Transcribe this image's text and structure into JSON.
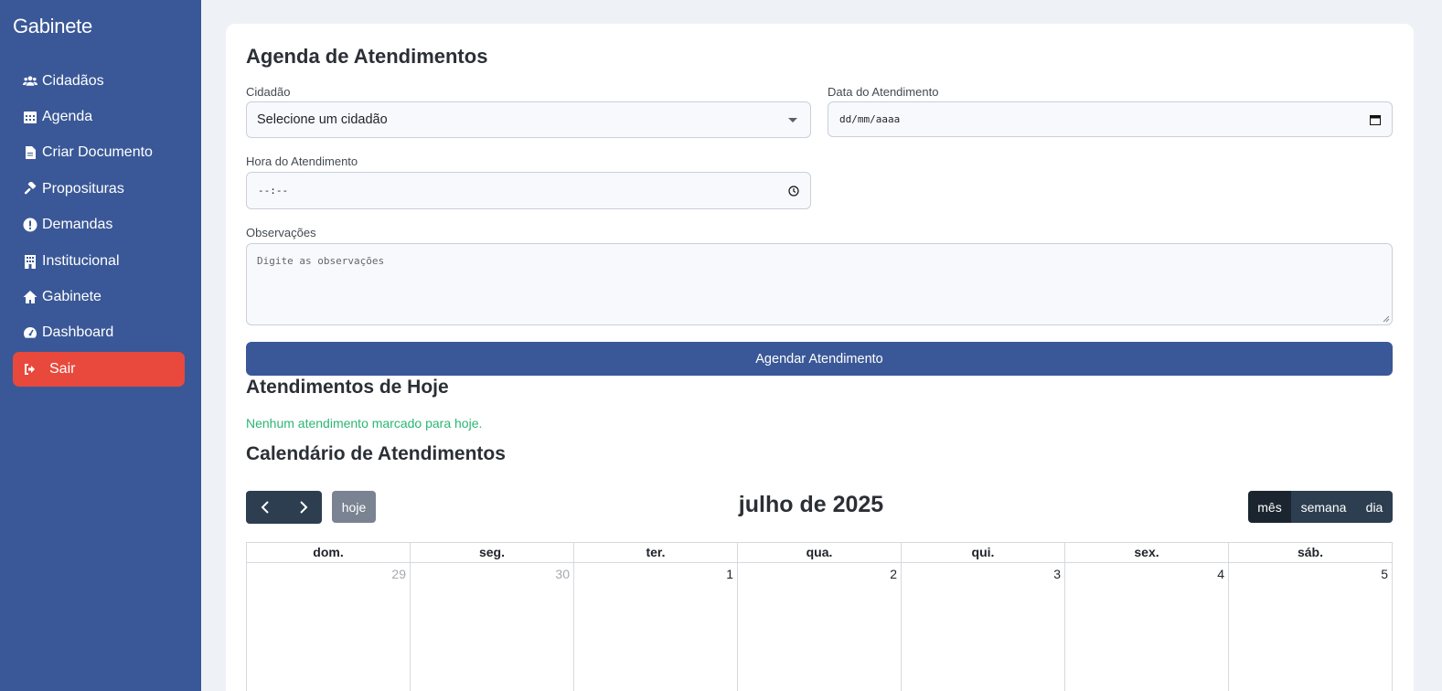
{
  "sidebar": {
    "brand": "Gabinete",
    "items": [
      {
        "label": "Cidadãos",
        "icon": "users-icon"
      },
      {
        "label": "Agenda",
        "icon": "calendar-icon"
      },
      {
        "label": "Criar Documento",
        "icon": "document-icon"
      },
      {
        "label": "Proposituras",
        "icon": "gavel-icon"
      },
      {
        "label": "Demandas",
        "icon": "alert-circle-icon"
      },
      {
        "label": "Institucional",
        "icon": "building-icon"
      },
      {
        "label": "Gabinete",
        "icon": "home-icon"
      },
      {
        "label": "Dashboard",
        "icon": "gauge-icon"
      }
    ],
    "logout": {
      "label": "Sair",
      "icon": "sign-out-icon"
    }
  },
  "form": {
    "title": "Agenda de Atendimentos",
    "citizen_label": "Cidadão",
    "citizen_value": "Selecione um cidadão",
    "date_label": "Data do Atendimento",
    "date_value": "dd/mm/aaaa",
    "time_label": "Hora do Atendimento",
    "time_value": "--:--",
    "notes_label": "Observações",
    "notes_placeholder": "Digite as observações",
    "submit_label": "Agendar Atendimento"
  },
  "today": {
    "title": "Atendimentos de Hoje",
    "empty_message": "Nenhum atendimento marcado para hoje."
  },
  "calendar": {
    "title": "Calendário de Atendimentos",
    "today_label": "hoje",
    "month_title": "julho de 2025",
    "views": [
      "mês",
      "semana",
      "dia"
    ],
    "active_view": "mês",
    "weekdays": [
      "dom.",
      "seg.",
      "ter.",
      "qua.",
      "qui.",
      "sex.",
      "sáb."
    ],
    "first_week": [
      {
        "day": "29",
        "other_month": true
      },
      {
        "day": "30",
        "other_month": true
      },
      {
        "day": "1",
        "other_month": false
      },
      {
        "day": "2",
        "other_month": false
      },
      {
        "day": "3",
        "other_month": false
      },
      {
        "day": "4",
        "other_month": false
      },
      {
        "day": "5",
        "other_month": false
      }
    ]
  },
  "colors": {
    "sidebar": "#3a5897",
    "logout": "#e8493c",
    "primary_button": "#3a5897",
    "success_text": "#2bb673",
    "calendar_button": "#2c3e50"
  }
}
